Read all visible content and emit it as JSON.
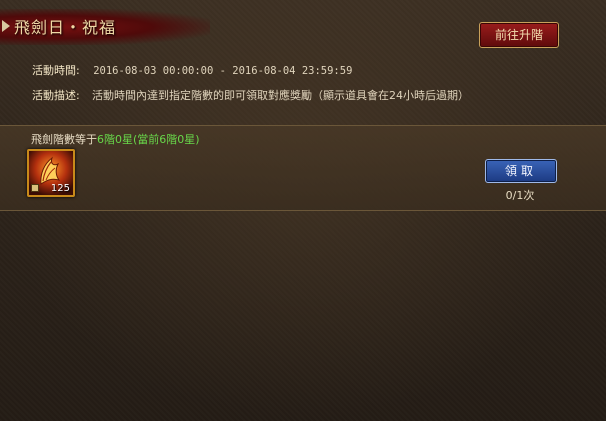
{
  "header": {
    "title": "飛劍日・祝福",
    "upgrade_button": "前往升階"
  },
  "info": {
    "time_label": "活動時間:",
    "time_value": "2016-08-03 00:00:00 - 2016-08-04 23:59:59",
    "desc_label": "活動描述:",
    "desc_value": "活動時間內達到指定階數的即可領取對應獎勵（顯示道具會在24小時后過期）"
  },
  "task": {
    "desc_prefix": "飛劍階數等于",
    "desc_target": "6階0星",
    "desc_current": "(當前6階0星)",
    "reward": {
      "icon": "wing-item-icon",
      "count": "125"
    },
    "claim_button": "領取",
    "claim_count": "0/1次"
  },
  "colors": {
    "highlight_green": "#68d84a",
    "title_gold": "#f0d9a6",
    "upgrade_red": "#9a1c1c",
    "claim_blue": "#3a64b8"
  }
}
